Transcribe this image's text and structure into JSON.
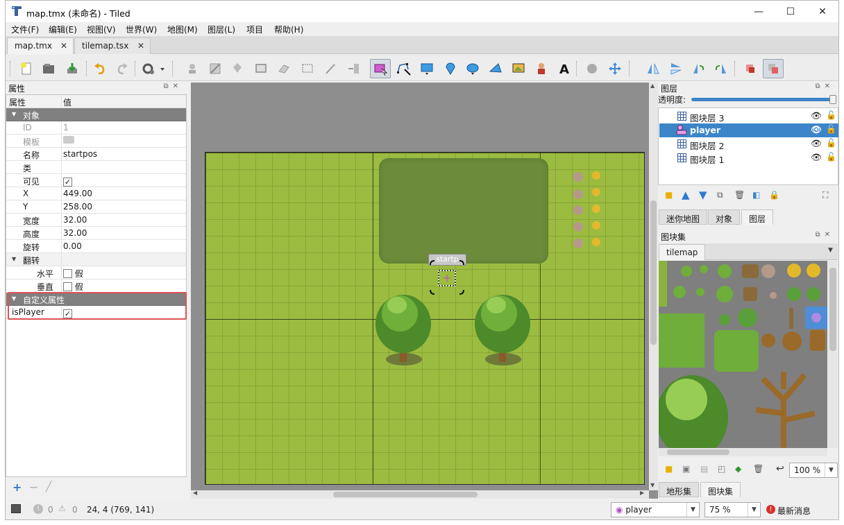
{
  "window": {
    "title": "map.tmx (未命名) - Tiled",
    "minimize": "—",
    "maximize": "☐",
    "close": "✕"
  },
  "menu": [
    "文件(F)",
    "编辑(E)",
    "视图(V)",
    "世界(W)",
    "地图(M)",
    "图层(L)",
    "项目",
    "帮助(H)"
  ],
  "tabs": [
    {
      "label": "map.tmx",
      "close": "✕"
    },
    {
      "label": "tilemap.tsx",
      "close": "✕"
    }
  ],
  "properties": {
    "dock_title": "属性",
    "col_name": "属性",
    "col_value": "值",
    "group_object": "对象",
    "rows": [
      {
        "key": "ID",
        "value": "1"
      },
      {
        "key": "模板",
        "value": ""
      },
      {
        "key": "名称",
        "value": "startpos"
      },
      {
        "key": "类",
        "value": ""
      },
      {
        "key": "可见",
        "value": "✓"
      },
      {
        "key": "X",
        "value": "449.00"
      },
      {
        "key": "Y",
        "value": "258.00"
      },
      {
        "key": "宽度",
        "value": "32.00"
      },
      {
        "key": "高度",
        "value": "32.00"
      },
      {
        "key": "旋转",
        "value": "0.00"
      }
    ],
    "group_flip": "翻转",
    "flip_rows": [
      {
        "key": "水平",
        "value": "假"
      },
      {
        "key": "垂直",
        "value": "假"
      }
    ],
    "group_custom": "自定义属性",
    "custom_rows": [
      {
        "key": "isPlayer",
        "value": "✓"
      }
    ]
  },
  "map": {
    "object_label": "startp"
  },
  "layers": {
    "dock_title": "图层",
    "opacity_label": "透明度:",
    "items": [
      "图块层 3",
      "player",
      "图块层 2",
      "图块层 1"
    ],
    "selected": "player",
    "tabs": [
      "迷你地图",
      "对象",
      "图层"
    ],
    "active_tab": "图层"
  },
  "tilesets": {
    "dock_title": "图块集",
    "tab": "tilemap",
    "zoom": "100 %",
    "tabs": [
      "地形集",
      "图块集"
    ],
    "active_tab": "图块集"
  },
  "status": {
    "errors": "0",
    "warnings": "0",
    "coords": "24, 4 (769, 141)",
    "layer_select": "player",
    "zoom": "75 %",
    "news": "最新消息"
  },
  "colors": {
    "selection": "#3c85c9",
    "highlight_border": "#e05050",
    "grass": "#9bbc40"
  }
}
